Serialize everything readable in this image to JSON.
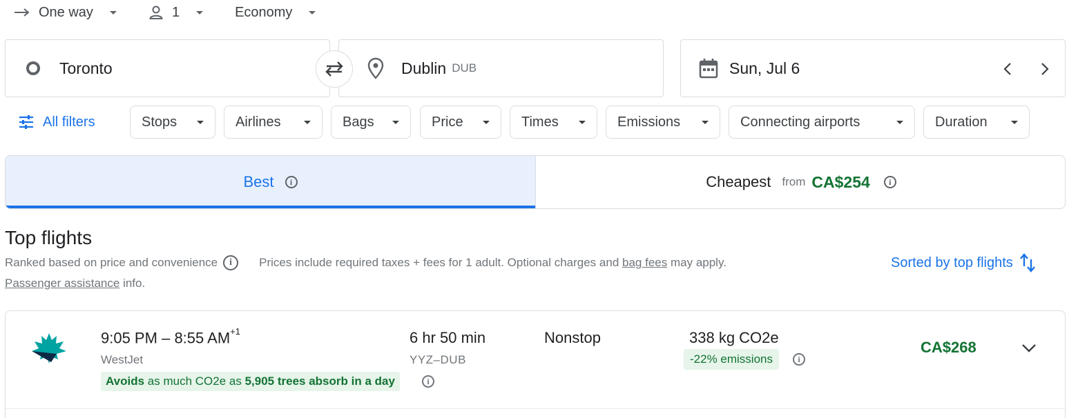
{
  "trip_options": {
    "trip_type": "One way",
    "passengers": "1",
    "cabin_class": "Economy"
  },
  "search": {
    "origin": "Toronto",
    "destination": "Dublin",
    "destination_code": "DUB",
    "date": "Sun, Jul 6"
  },
  "filters": {
    "all_filters_label": "All filters",
    "chips": [
      "Stops",
      "Airlines",
      "Bags",
      "Price",
      "Times",
      "Emissions",
      "Connecting airports",
      "Duration"
    ]
  },
  "tabs": {
    "best_label": "Best",
    "cheapest_label": "Cheapest",
    "from_label": "from",
    "cheapest_price": "CA$254"
  },
  "results": {
    "title": "Top flights",
    "ranked_text": "Ranked based on price and convenience",
    "prices_text_pre": "Prices include required taxes + fees for 1 adult. Optional charges and",
    "bag_fees_link": "bag fees",
    "prices_text_post": "may apply.",
    "passenger_assistance_link": "Passenger assistance",
    "passenger_assistance_post": "info.",
    "sort_label": "Sorted by top flights"
  },
  "flights": [
    {
      "departure": "9:05 PM",
      "separator": "–",
      "arrival": "8:55 AM",
      "day_offset": "+1",
      "airline": "WestJet",
      "avoid_word": "Avoids",
      "avoid_mid": "as much CO2e as",
      "avoid_trees": "5,905 trees absorb in a day",
      "duration": "6 hr 50 min",
      "route": "YYZ–DUB",
      "stops": "Nonstop",
      "emissions": "338 kg CO2e",
      "emissions_delta": "-22% emissions",
      "price": "CA$268"
    }
  ],
  "colors": {
    "accent_blue": "#1a73e8",
    "price_green": "#137333",
    "green_bg": "#e6f4ea",
    "best_tab_bg": "#e8f0fe",
    "westjet_teal": "#00a3a1",
    "westjet_navy": "#0e2a47"
  }
}
